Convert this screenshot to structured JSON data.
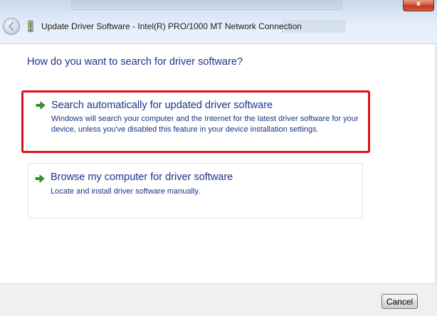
{
  "window": {
    "title": "Update Driver Software - Intel(R) PRO/1000 MT Network Connection",
    "close_label": "x",
    "back_icon": "back-arrow-icon",
    "device_icon": "network-adapter-icon"
  },
  "main": {
    "heading": "How do you want to search for driver software?",
    "options": [
      {
        "title": "Search automatically for updated driver software",
        "description": "Windows will search your computer and the Internet for the latest driver software for your device, unless you've disabled this feature in your device installation settings.",
        "icon": "green-arrow-icon",
        "highlighted": true
      },
      {
        "title": "Browse my computer for driver software",
        "description": "Locate and install driver software manually.",
        "icon": "green-arrow-icon",
        "highlighted": false
      }
    ]
  },
  "footer": {
    "cancel_label": "Cancel"
  },
  "colors": {
    "link_blue": "#1e3287",
    "highlight_red": "#e01018",
    "arrow_green": "#2e9d2a"
  }
}
